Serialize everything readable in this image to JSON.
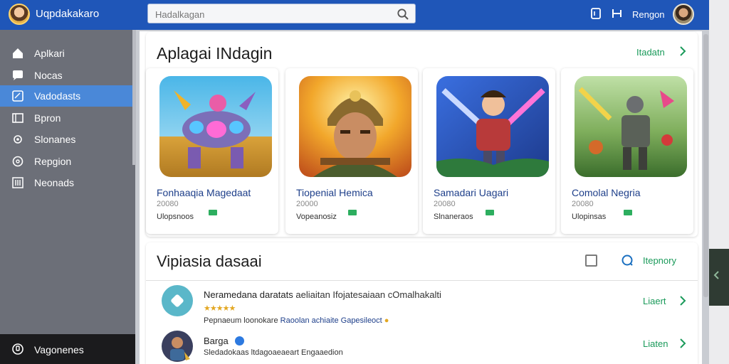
{
  "app": {
    "title": "Uqpdakakaro"
  },
  "search": {
    "placeholder": "Hadalkagan"
  },
  "user": {
    "name": "Rengon"
  },
  "sidebar": {
    "items": [
      {
        "label": "Aplkari",
        "icon": "home-icon"
      },
      {
        "label": "Nocas",
        "icon": "chat-icon"
      },
      {
        "label": "Vadodasts",
        "icon": "grid-icon",
        "active": true
      },
      {
        "label": "Bpron",
        "icon": "window-icon"
      },
      {
        "label": "Slonanes",
        "icon": "settings-icon"
      },
      {
        "label": "Repgion",
        "icon": "help-icon"
      },
      {
        "label": "Neonads",
        "icon": "list-icon"
      }
    ],
    "bottom": {
      "label": "Vagonenes",
      "icon": "power-icon"
    }
  },
  "featured": {
    "title": "Aplagai INdagin",
    "see_all": "Itadatn",
    "cards": [
      {
        "name": "Fonhaaqia Magedaat",
        "num": "20080",
        "sub": "Ulopsnoos"
      },
      {
        "name": "Tiopenial Hemica",
        "num": "20000",
        "sub": "Vopeanosiz"
      },
      {
        "name": "Samadari Uagari",
        "num": "20080",
        "sub": "Slnaneraos"
      },
      {
        "name": "Comolal Negria",
        "num": "20080",
        "sub": "Ulopinsas"
      }
    ]
  },
  "updates": {
    "title": "Vipiasia dasaai",
    "filter_label": "Itepnory",
    "rows": [
      {
        "title": "Neramedana daratats",
        "title_tail": "aeliaitan Ifojatesaiaan cOmalhakalti",
        "stars": "★★★★★",
        "desc": "Pepnaeum loonokare",
        "desc_hl": "Raoolan achiaite Gapesileoct",
        "action": "Liaert"
      },
      {
        "title": "Barga",
        "desc": "Sledadokaas ltdagoaeaeart Engaaedion",
        "action": "Liaten"
      }
    ]
  },
  "colors": {
    "topbar": "#1f56b8",
    "sidebar": "#6c6f78",
    "accent": "#1a9a5a",
    "active": "#4a88d8"
  }
}
